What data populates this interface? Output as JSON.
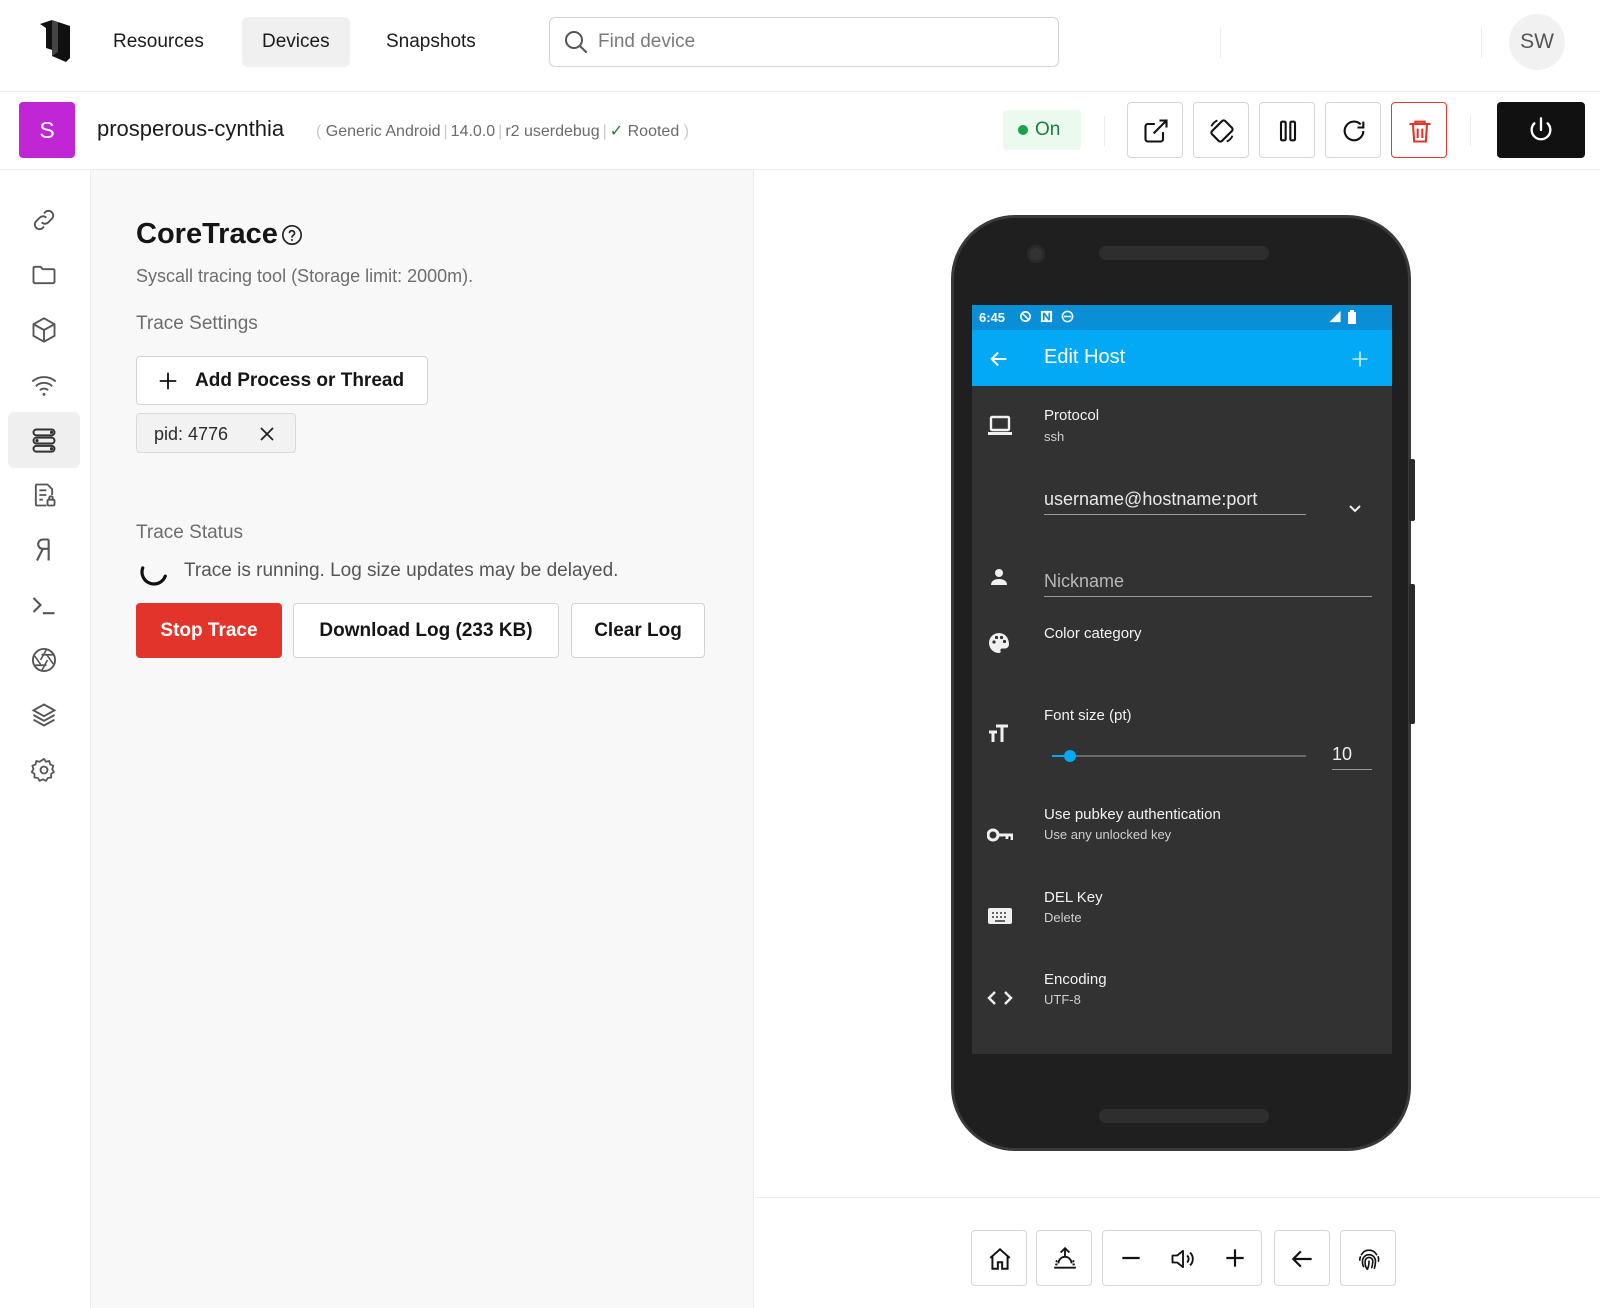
{
  "nav": {
    "links": [
      "Resources",
      "Devices",
      "Snapshots"
    ],
    "active": "Devices",
    "search_placeholder": "Find device",
    "user_initials": "SW"
  },
  "device": {
    "badge": "S",
    "name": "prosperous-cynthia",
    "model": "Generic Android",
    "os_version": "14.0.0",
    "build": "r2 userdebug",
    "rooted": "Rooted",
    "status": "On",
    "toolbar_icons": [
      "open-external-icon",
      "rotate-icon",
      "pause-icon",
      "restart-icon",
      "trash-icon"
    ],
    "power_icon": "power-icon"
  },
  "sidebar": {
    "icons": [
      "link-icon",
      "folder-icon",
      "cube-icon",
      "wifi-icon",
      "trace-icon",
      "file-lock-icon",
      "frida-icon",
      "terminal-icon",
      "camera-aperture-icon",
      "layers-icon",
      "gear-icon"
    ],
    "active_index": 4
  },
  "panel": {
    "title": "CoreTrace",
    "subtitle": "Syscall tracing tool (Storage limit: 2000m).",
    "trace_settings_label": "Trace Settings",
    "add_button": "Add Process or Thread",
    "chip": "pid: 4776",
    "trace_status_label": "Trace Status",
    "running_text": "Trace is running. Log size updates may be delayed.",
    "stop_button": "Stop Trace",
    "download_button": "Download Log (233 KB)",
    "clear_button": "Clear Log"
  },
  "phone": {
    "time": "6:45",
    "appbar_title": "Edit Host",
    "protocol_label": "Protocol",
    "protocol_value": "ssh",
    "host_field": "username@hostname:port",
    "nickname_placeholder": "Nickname",
    "color_category": "Color category",
    "font_size_label": "Font size (pt)",
    "font_size_value": "10",
    "font_slider_fraction": 0.07,
    "pubkey_label": "Use pubkey authentication",
    "pubkey_value": "Use any unlocked key",
    "del_key_label": "DEL Key",
    "del_key_value": "Delete",
    "encoding_label": "Encoding",
    "encoding_value": "UTF-8",
    "accent_color": "#03a9f4"
  },
  "controls": {
    "icons": [
      "home-icon",
      "sunrise-icon",
      "volume-down-icon",
      "volume-icon",
      "volume-up-icon",
      "back-arrow-icon",
      "fingerprint-icon"
    ]
  },
  "colors": {
    "accent_red": "#e2342b",
    "status_green": "#16a34a",
    "device_badge": "#c026d3"
  }
}
